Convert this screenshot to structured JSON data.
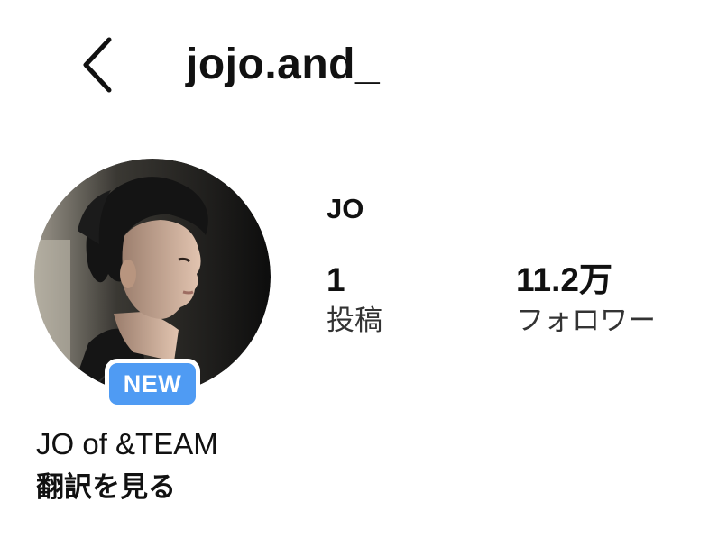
{
  "header": {
    "back_icon": "chevron-left-icon",
    "username": "jojo.and_"
  },
  "profile": {
    "avatar_badge": "NEW",
    "display_name": "JO",
    "bio": "JO of &TEAM",
    "translate_label": "翻訳を見る"
  },
  "stats": [
    {
      "count": "1",
      "label": "投稿"
    },
    {
      "count": "11.2万",
      "label": "フォロワー"
    }
  ],
  "colors": {
    "badge_background": "#4f9bf3",
    "text_primary": "#111111",
    "background": "#ffffff"
  }
}
